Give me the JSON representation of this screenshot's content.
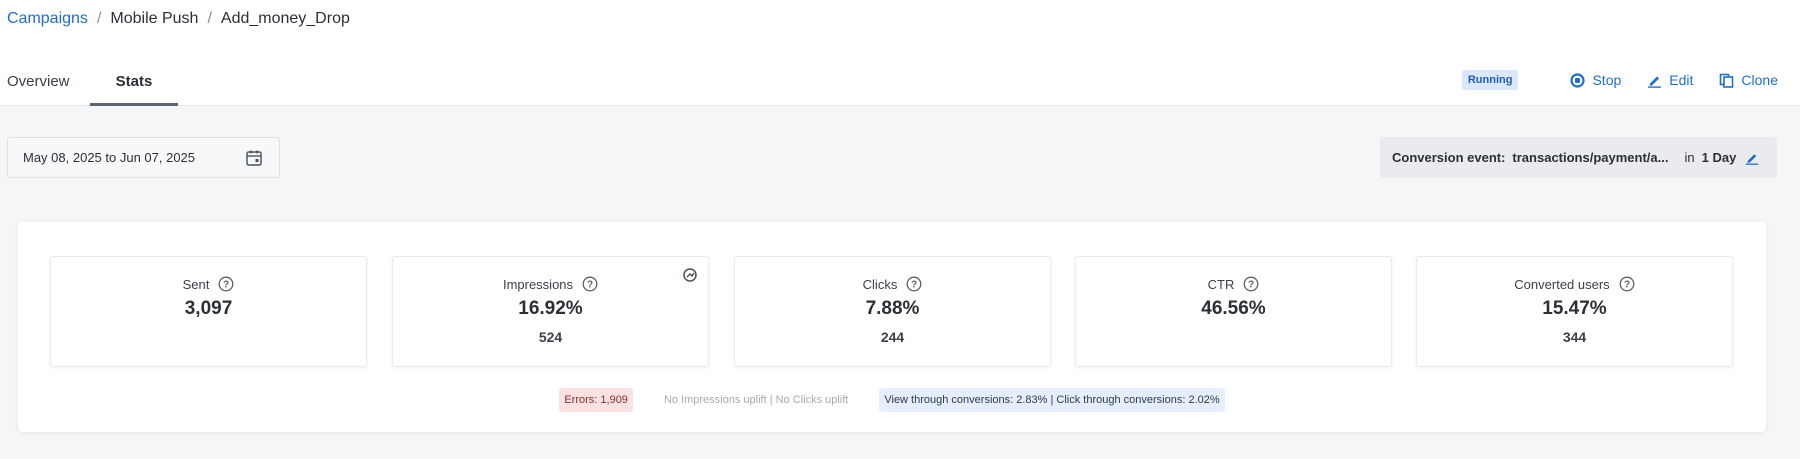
{
  "breadcrumb": {
    "root": "Campaigns",
    "section": "Mobile Push",
    "current": "Add_money_Drop",
    "separator": "/"
  },
  "tabs": [
    {
      "label": "Overview",
      "active": false
    },
    {
      "label": "Stats",
      "active": true
    }
  ],
  "actions": {
    "status": "Running",
    "stop": "Stop",
    "edit": "Edit",
    "clone": "Clone"
  },
  "filters": {
    "date_range": "May 08, 2025 to Jun 07, 2025",
    "conversion_label": "Conversion event:",
    "conversion_event": "transactions/payment/a...",
    "conversion_in": "in",
    "conversion_window": "1 Day"
  },
  "stats": [
    {
      "label": "Sent",
      "value": "3,097",
      "sub": ""
    },
    {
      "label": "Impressions",
      "value": "16.92%",
      "sub": "524"
    },
    {
      "label": "Clicks",
      "value": "7.88%",
      "sub": "244"
    },
    {
      "label": "CTR",
      "value": "46.56%",
      "sub": ""
    },
    {
      "label": "Converted users",
      "value": "15.47%",
      "sub": "344"
    }
  ],
  "notes": {
    "errors": "Errors: 1,909",
    "uplift": "No Impressions uplift | No Clicks uplift",
    "conversions": "View through conversions: 2.83% | Click through conversions: 2.02%"
  },
  "colors": {
    "accent": "#1f6fc8",
    "running_badge_bg": "#dbe7fb",
    "errors_bg": "#fbe1e1",
    "conversions_bg": "#e6eefb"
  },
  "icons": {
    "stop": "stop-circle-icon",
    "edit": "pencil-icon",
    "clone": "copy-icon",
    "calendar": "calendar-icon",
    "help": "question-circle-icon",
    "impressions_corner": "chart-refresh-icon"
  }
}
